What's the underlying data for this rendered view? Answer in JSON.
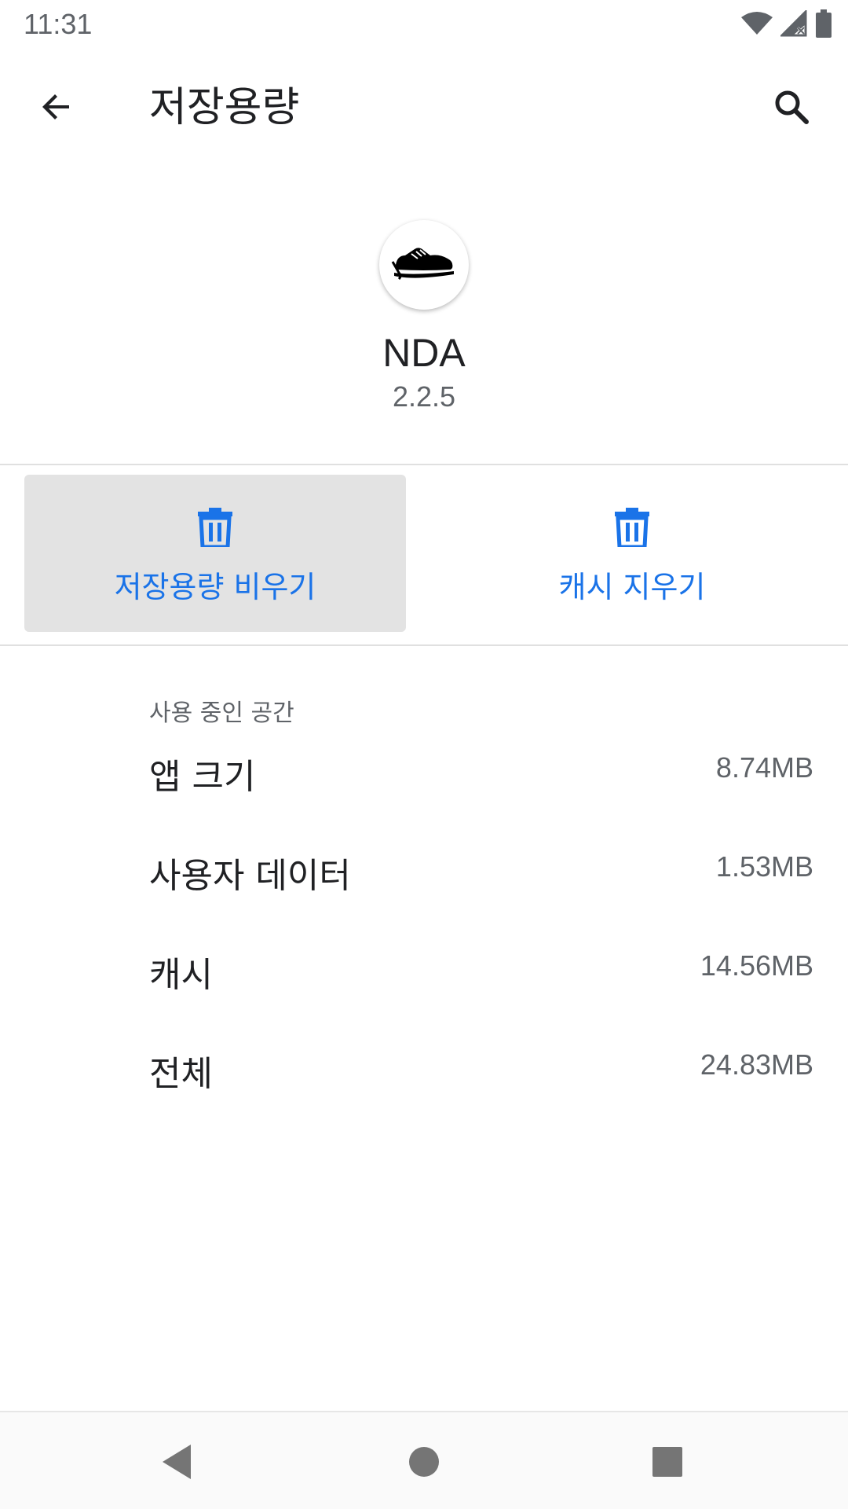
{
  "status_bar": {
    "time": "11:31",
    "icons": [
      "wifi-icon",
      "cell-signal-no-service-icon",
      "battery-icon"
    ]
  },
  "app_bar": {
    "title": "저장용량",
    "back_icon": "arrow-back-icon",
    "search_icon": "search-icon"
  },
  "app": {
    "name": "NDA",
    "version": "2.2.5",
    "icon_logo_text": "NDA"
  },
  "actions": {
    "clear_storage_label": "저장용량 비우기",
    "clear_cache_label": "캐시 지우기",
    "icon": "trash-icon"
  },
  "storage": {
    "section_label": "사용 중인 공간",
    "rows": [
      {
        "label": "앱 크기",
        "value": "8.74MB"
      },
      {
        "label": "사용자 데이터",
        "value": "1.53MB"
      },
      {
        "label": "캐시",
        "value": "14.56MB"
      },
      {
        "label": "전체",
        "value": "24.83MB"
      }
    ]
  },
  "nav_bar": {
    "icons": [
      "nav-back-icon",
      "nav-home-icon",
      "nav-recents-icon"
    ]
  },
  "colors": {
    "accent": "#1a73e8",
    "pressed_button_bg": "#e3e3e3",
    "primary_text": "#202124",
    "secondary_text": "#5f6368"
  }
}
